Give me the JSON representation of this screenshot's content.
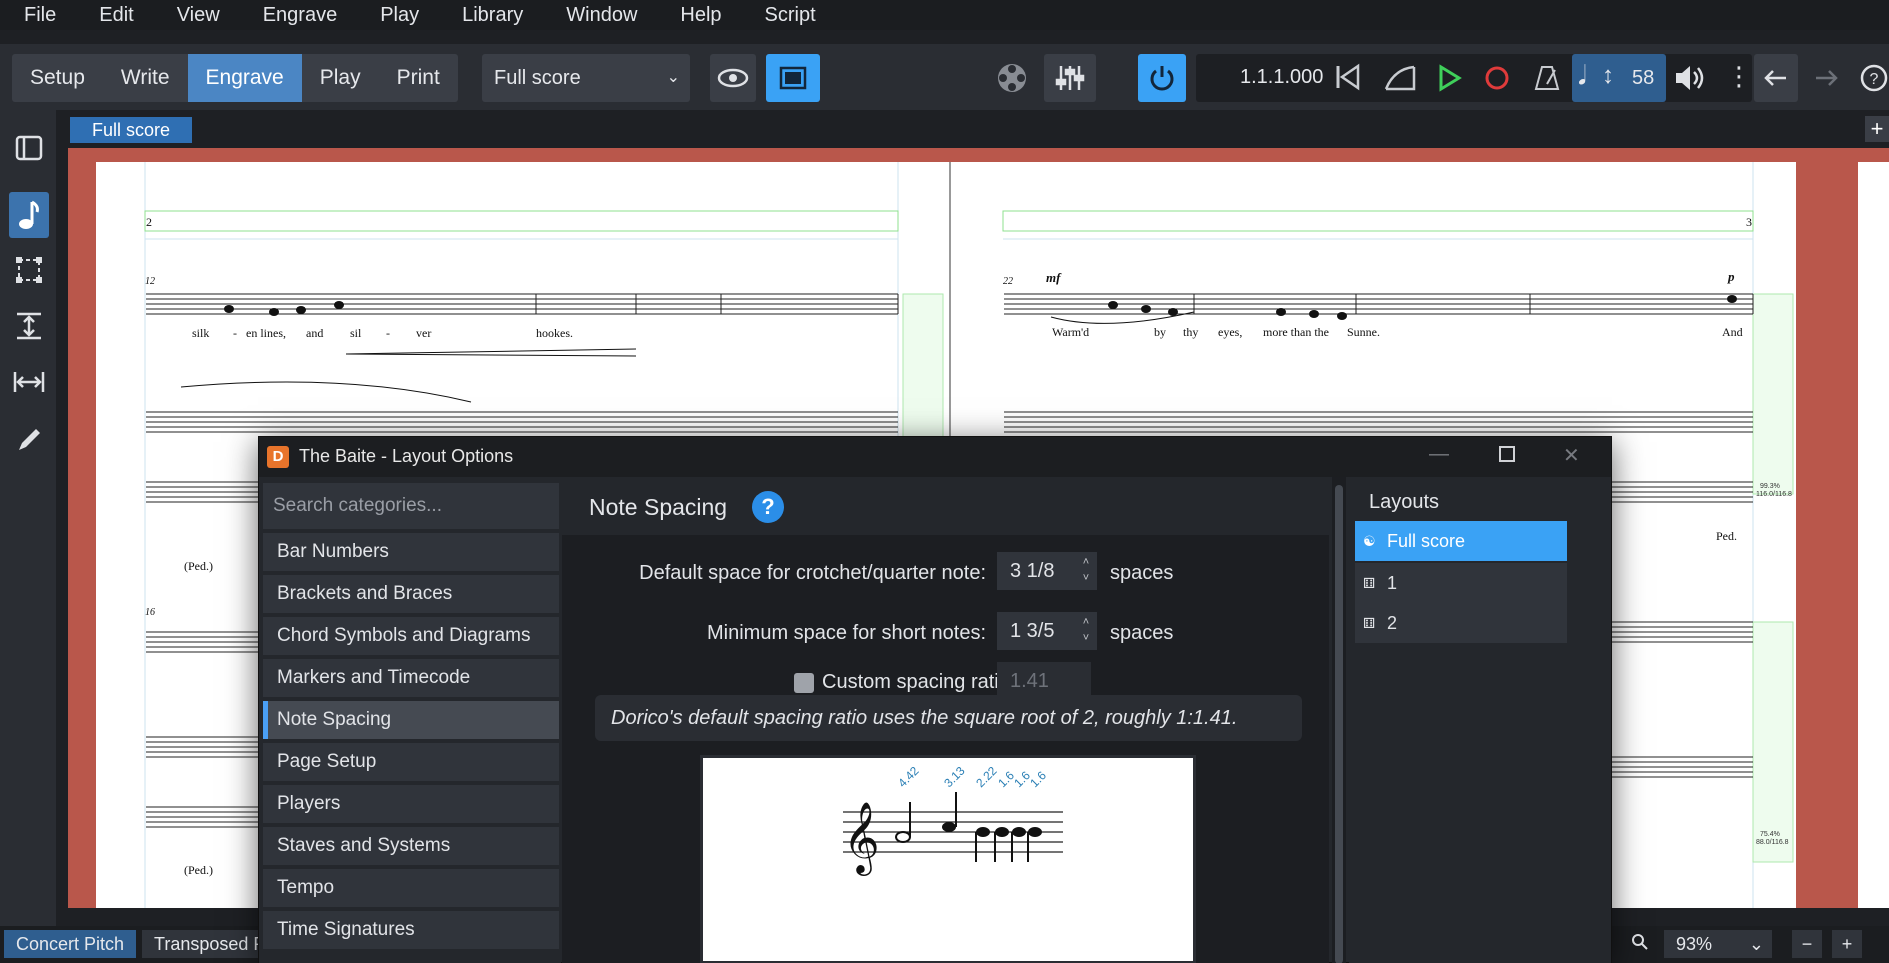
{
  "menu": [
    "File",
    "Edit",
    "View",
    "Engrave",
    "Play",
    "Library",
    "Window",
    "Help",
    "Script"
  ],
  "modes": {
    "setup": "Setup",
    "write": "Write",
    "engrave": "Engrave",
    "play": "Play",
    "print": "Print"
  },
  "layout_selector": "Full score",
  "transport": {
    "position": "1.1.1.000",
    "tempo": "58"
  },
  "tab": "Full score",
  "score": {
    "page_left_number": "2",
    "page_right_number": "3",
    "bar12": "12",
    "bar16": "16",
    "bar22": "22",
    "lyrics_left": [
      "silk",
      "-",
      "en lines,",
      "and",
      "sil",
      "-",
      "ver",
      "hookes."
    ],
    "lyrics_right": [
      "Warm'd",
      "by",
      "thy",
      "eyes,",
      "more than the",
      "Sunne.",
      "And"
    ],
    "dyn_mf": "mf",
    "dyn_p": "p",
    "ped": "(Ped.)",
    "ped2": "Ped.",
    "pct1": "99.3%",
    "ratio1": "116.0/116.8",
    "pct2": "75.4%",
    "ratio2": "88.0/116.8"
  },
  "status": {
    "concert_pitch": "Concert Pitch",
    "transposed": "Transposed P",
    "zoom": "93%"
  },
  "dialog": {
    "title": "The Baite - Layout Options",
    "search_placeholder": "Search categories...",
    "categories": [
      "Bar Numbers",
      "Brackets and Braces",
      "Chord Symbols and Diagrams",
      "Markers and Timecode",
      "Note Spacing",
      "Page Setup",
      "Players",
      "Staves and Systems",
      "Tempo",
      "Time Signatures"
    ],
    "selected_category": "Note Spacing",
    "heading": "Note Spacing",
    "crotchet_label": "Default space for crotchet/quarter note:",
    "crotchet_value": "3 1/8",
    "short_label": "Minimum space for short notes:",
    "short_value": "1 3/5",
    "spaces": "spaces",
    "ratio_label": "Custom spacing ratio:",
    "ratio_value": "1.41",
    "info": "Dorico's default spacing ratio uses the square root of 2, roughly 1:1.41.",
    "preview_labels": [
      "4.42",
      "3.13",
      "2.22",
      "1.6",
      "1.6",
      "1.6"
    ],
    "layouts_heading": "Layouts",
    "layouts": [
      "Full score",
      "1",
      "2"
    ]
  },
  "colors": {
    "accent": "#3aa2f5",
    "canvas": "#b9574b",
    "active_mode": "#4b86c4"
  }
}
